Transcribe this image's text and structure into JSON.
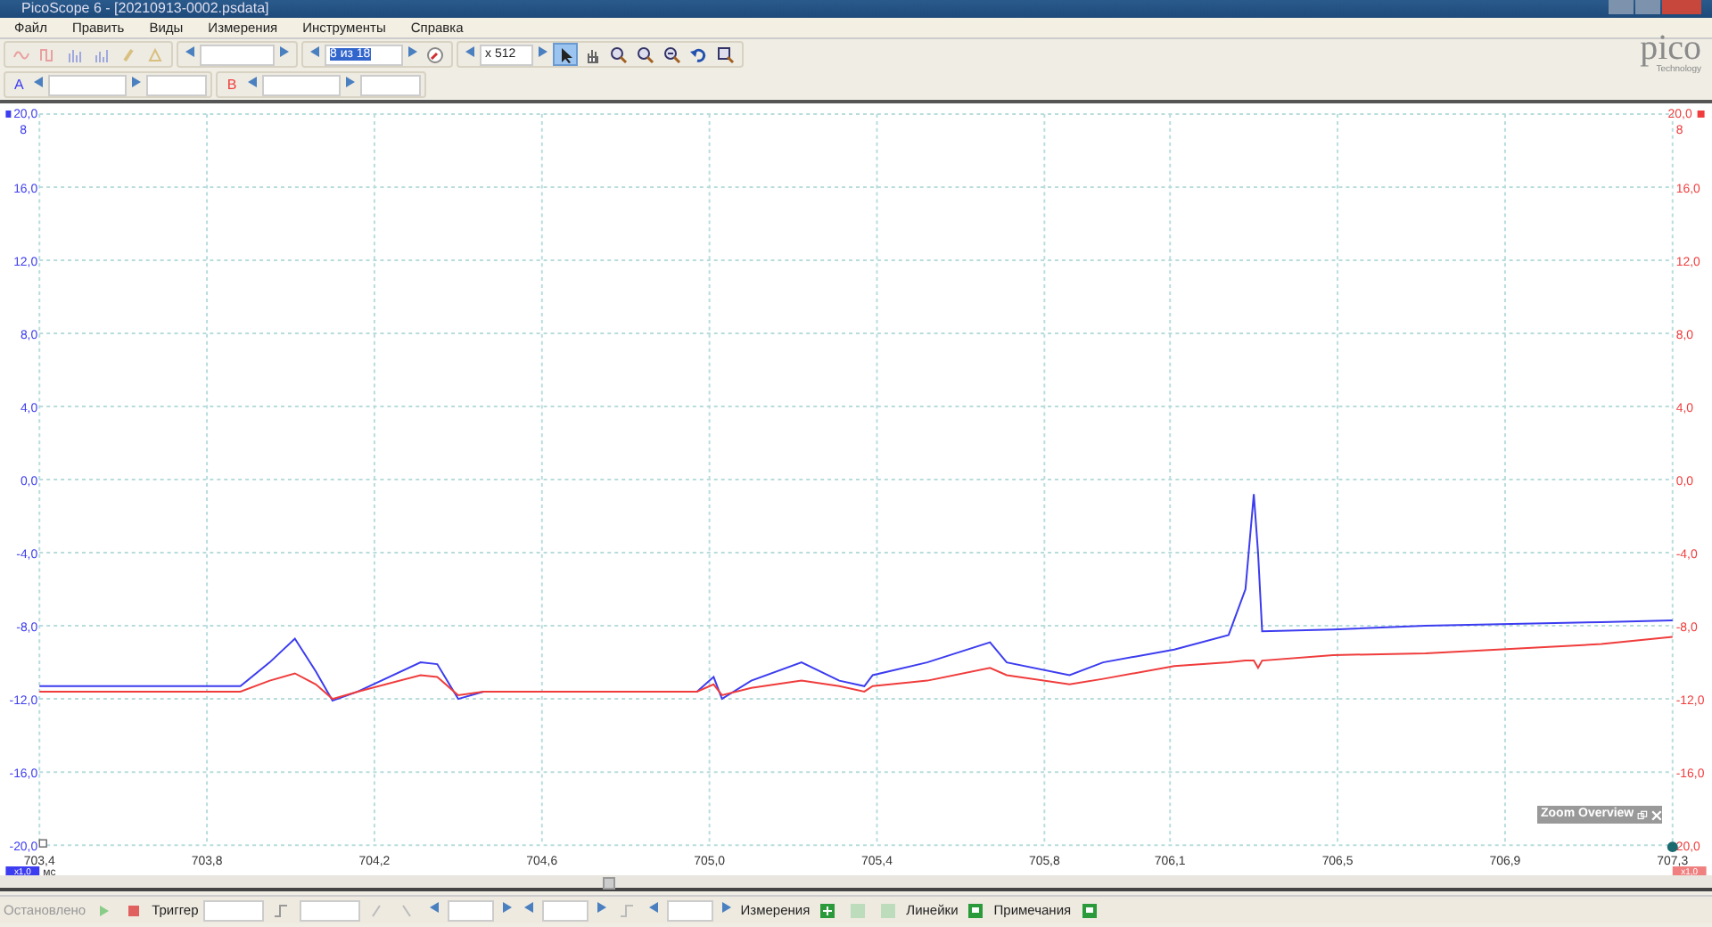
{
  "window": {
    "title": "PicoScope 6 - [20210913-0002.psdata]"
  },
  "menu": [
    {
      "label": "Файл"
    },
    {
      "label": "Править"
    },
    {
      "label": "Виды"
    },
    {
      "label": "Измерения"
    },
    {
      "label": "Инструменты"
    },
    {
      "label": "Справка"
    }
  ],
  "toolbar": {
    "buffer": {
      "value": "8 из 18",
      "selected": true
    },
    "zoom": {
      "value": "x 512"
    },
    "tools": [
      {
        "kind": "pointer",
        "selected": true
      },
      {
        "kind": "hand",
        "selected": false
      },
      {
        "kind": "zoom-in",
        "selected": false
      },
      {
        "kind": "zoom-in",
        "selected": false
      },
      {
        "kind": "zoom-out",
        "selected": false
      },
      {
        "kind": "undo",
        "selected": false
      },
      {
        "kind": "zoom-fit",
        "selected": false
      }
    ]
  },
  "logo": {
    "name": "pico",
    "tagline": "Technology"
  },
  "channels": [
    {
      "label": "A",
      "color": "#3c3cf0"
    },
    {
      "label": "B",
      "color": "#f03c3c"
    }
  ],
  "chart": {
    "left_top_mark": "8",
    "right_top_mark": "8",
    "right_axis_labels": [
      "20,0",
      "16,0",
      "12,0",
      "8,0",
      "4,0",
      "0,0",
      "-4,0",
      "-8,0",
      "-12,0",
      "-16,0",
      "20,0"
    ],
    "left_scale": "x1,0",
    "right_scale": "x1,0",
    "zoom_overview": {
      "title": "Zoom Overview"
    },
    "chart_data": {
      "type": "line",
      "xlabel": "мс",
      "grid": true,
      "xlim": [
        703.4,
        707.3
      ],
      "ylim": [
        -20,
        20
      ],
      "xticks": [
        {
          "value": 703.4,
          "label": "703,4"
        },
        {
          "value": 703.8,
          "label": "703,8"
        },
        {
          "value": 704.2,
          "label": "704,2"
        },
        {
          "value": 704.6,
          "label": "704,6"
        },
        {
          "value": 705.0,
          "label": "705,0"
        },
        {
          "value": 705.4,
          "label": "705,4"
        },
        {
          "value": 705.8,
          "label": "705,8"
        },
        {
          "value": 706.1,
          "label": "706,1"
        },
        {
          "value": 706.5,
          "label": "706,5"
        },
        {
          "value": 706.9,
          "label": "706,9"
        },
        {
          "value": 707.3,
          "label": "707,3"
        }
      ],
      "yticks": [
        {
          "value": 20,
          "label": "20,0"
        },
        {
          "value": 16,
          "label": "16,0"
        },
        {
          "value": 12,
          "label": "12,0"
        },
        {
          "value": 8,
          "label": "8,0"
        },
        {
          "value": 4,
          "label": "4,0"
        },
        {
          "value": 0,
          "label": "0,0"
        },
        {
          "value": -4,
          "label": "-4,0"
        },
        {
          "value": -8,
          "label": "-8,0"
        },
        {
          "value": -12,
          "label": "-12,0"
        },
        {
          "value": -16,
          "label": "-16,0"
        },
        {
          "value": -20,
          "label": "-20,0"
        }
      ],
      "x": [
        703.4,
        703.88,
        703.95,
        704.01,
        704.06,
        704.1,
        704.16,
        704.31,
        704.35,
        704.4,
        704.46,
        704.97,
        705.01,
        705.03,
        705.1,
        705.22,
        705.31,
        705.37,
        705.39,
        705.52,
        705.67,
        705.71,
        705.86,
        705.94,
        706.11,
        706.24,
        706.28,
        706.3,
        706.31,
        706.32,
        706.49,
        706.71,
        707.13,
        707.3
      ],
      "series": [
        {
          "color": "#3c3cf0",
          "values": [
            -11.3,
            -11.3,
            -10.0,
            -8.7,
            -10.5,
            -12.1,
            -11.6,
            -10.0,
            -10.1,
            -12.0,
            -11.6,
            -11.6,
            -10.8,
            -12.0,
            -11.0,
            -10.0,
            -11.0,
            -11.3,
            -10.7,
            -10.0,
            -8.9,
            -10.0,
            -10.7,
            -10.0,
            -9.3,
            -8.5,
            -6.0,
            -0.8,
            -4.0,
            -8.3,
            -8.2,
            -8.0,
            -7.8,
            -7.7
          ]
        },
        {
          "color": "#f03c3c",
          "values": [
            -11.6,
            -11.6,
            -11.0,
            -10.6,
            -11.2,
            -12.0,
            -11.6,
            -10.7,
            -10.8,
            -11.8,
            -11.6,
            -11.6,
            -11.2,
            -11.8,
            -11.4,
            -11.0,
            -11.3,
            -11.6,
            -11.3,
            -11.0,
            -10.3,
            -10.7,
            -11.2,
            -10.9,
            -10.2,
            -10.0,
            -9.9,
            -9.9,
            -10.3,
            -9.9,
            -9.6,
            -9.5,
            -9.0,
            -8.6
          ]
        }
      ]
    }
  },
  "status_bar": {
    "state": "Остановлено",
    "trigger": "Триггер",
    "measurements": "Измерения",
    "rulers": "Линейки",
    "notes": "Примечания"
  }
}
